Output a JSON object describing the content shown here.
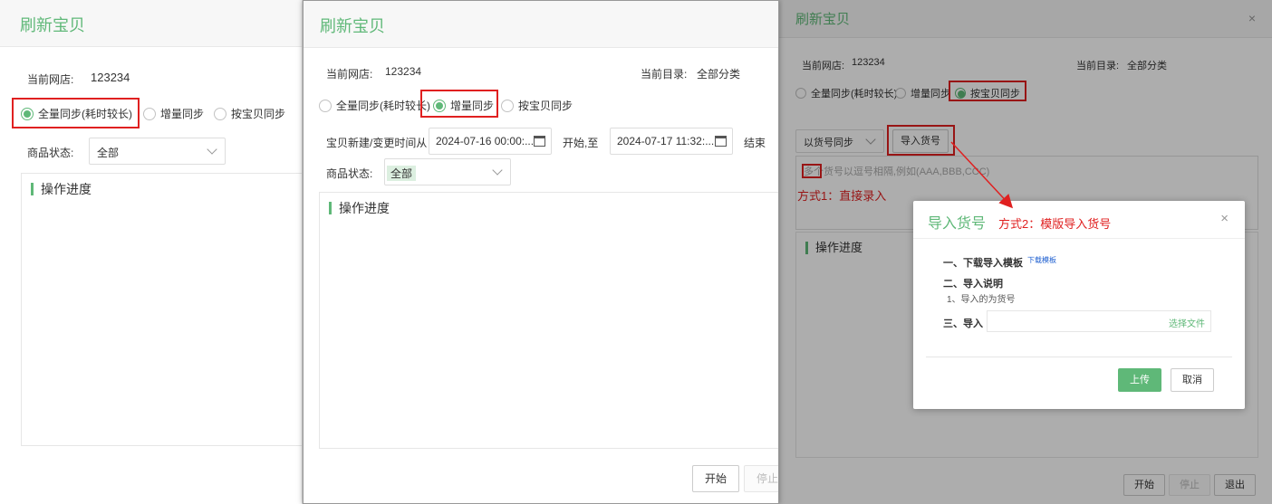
{
  "colors": {
    "accent": "#5fb878",
    "annotation": "#e02020"
  },
  "panel1": {
    "title": "刷新宝贝",
    "shop_label": "当前网店:",
    "shop_value": "123234",
    "radio_full": "全量同步(耗时较长)",
    "radio_incremental": "增量同步",
    "radio_by_item": "按宝贝同步",
    "status_label": "商品状态:",
    "status_value": "全部",
    "progress_title": "操作进度"
  },
  "panel2": {
    "title": "刷新宝贝",
    "shop_label": "当前网店:",
    "shop_value": "123234",
    "category_label": "当前目录:",
    "category_value": "全部分类",
    "radio_full": "全量同步(耗时较长)",
    "radio_incremental": "增量同步",
    "radio_by_item": "按宝贝同步",
    "time_from_label": "宝贝新建/变更时间从",
    "time_start_value": "2024-07-16 00:00:...",
    "time_start_suffix": "开始,至",
    "time_end_value": "2024-07-17 11:32:...",
    "time_end_suffix": "结束",
    "status_label": "商品状态:",
    "status_value": "全部",
    "progress_title": "操作进度",
    "start_button": "开始",
    "stop_button": "停止"
  },
  "panel3": {
    "title": "刷新宝贝",
    "close": "×",
    "shop_label": "当前网店:",
    "shop_value": "123234",
    "category_label": "当前目录:",
    "category_value": "全部分类",
    "radio_full": "全量同步(耗时较长)",
    "radio_incremental": "增量同步",
    "radio_by_item": "按宝贝同步",
    "sync_mode_value": "以货号同步",
    "import_button": "导入货号",
    "textarea_placeholder": "多个货号以逗号相隔,例如(AAA,BBB,CCC)",
    "annotation_method1": "方式1：直接录入",
    "progress_title": "操作进度",
    "start_button": "开始",
    "stop_button": "停止",
    "exit_button": "退出"
  },
  "dialog": {
    "title": "导入货号",
    "annotation_method2": "方式2：模版导入货号",
    "close": "×",
    "step1_label": "一、下载导入模板",
    "step1_link": "下载模板",
    "step2_label": "二、导入说明",
    "step2_note": "1、导入的为货号",
    "step3_label": "三、导入",
    "choose_file": "选择文件",
    "upload_button": "上传",
    "cancel_button": "取消"
  }
}
